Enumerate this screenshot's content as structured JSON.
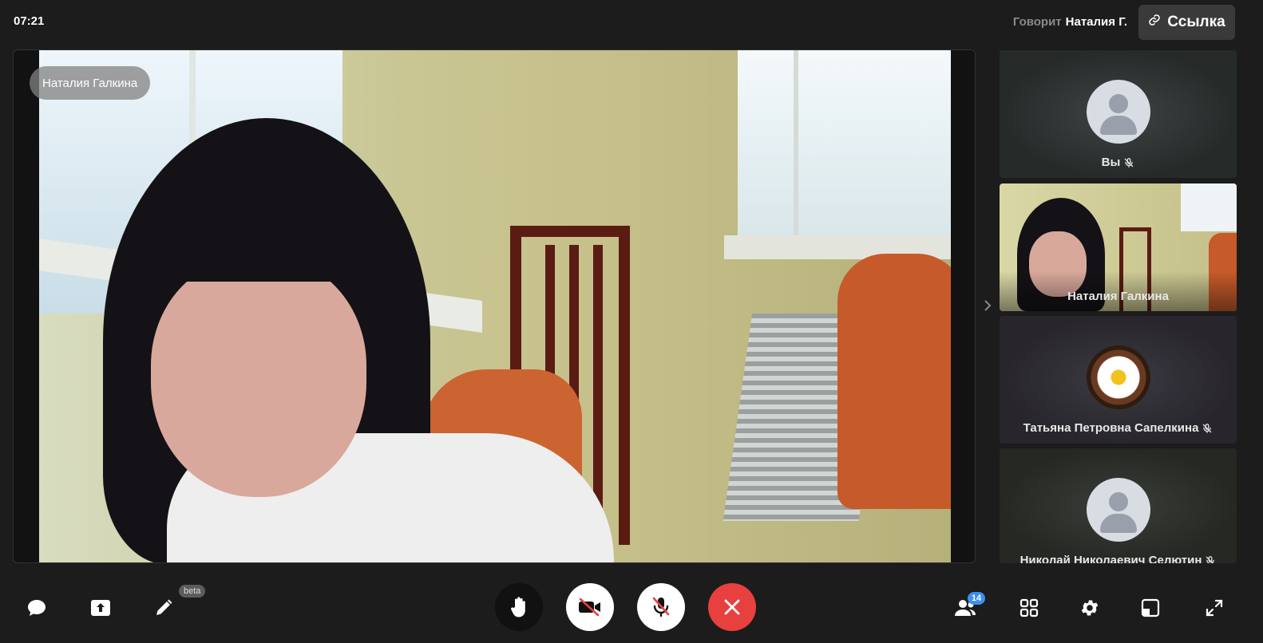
{
  "header": {
    "time": "07:21",
    "speaking_label": "Говорит",
    "speaking_name": "Наталия Г.",
    "link_button_label": "Ссылка"
  },
  "main_video": {
    "participant_name": "Наталия Галкина"
  },
  "sidebar": {
    "tiles": [
      {
        "name": "Вы",
        "muted": true,
        "avatar": "default-avatar-icon"
      },
      {
        "name": "Наталия Галкина",
        "muted": false,
        "avatar": "video"
      },
      {
        "name": "Татьяна Петровна Сапелкина",
        "muted": true,
        "avatar": "daisy-photo"
      },
      {
        "name": "Николай Николаевич Селютин",
        "muted": true,
        "avatar": "default-avatar-icon"
      }
    ]
  },
  "toolbar": {
    "beta_label": "beta",
    "participants_count": "14",
    "icons": {
      "chat": "chat-icon",
      "share_screen": "share-screen-icon",
      "draw": "pencil-icon",
      "raise_hand": "hand-icon",
      "camera": "camera-off-icon",
      "mic": "mic-off-icon",
      "leave": "close-icon",
      "participants": "participants-icon",
      "grid": "grid-icon",
      "settings": "gear-icon",
      "layout": "layout-icon",
      "fullscreen": "fullscreen-icon"
    }
  },
  "colors": {
    "background": "#1c1c1c",
    "leave_button": "#e8403f",
    "badge": "#3d8ef0"
  }
}
